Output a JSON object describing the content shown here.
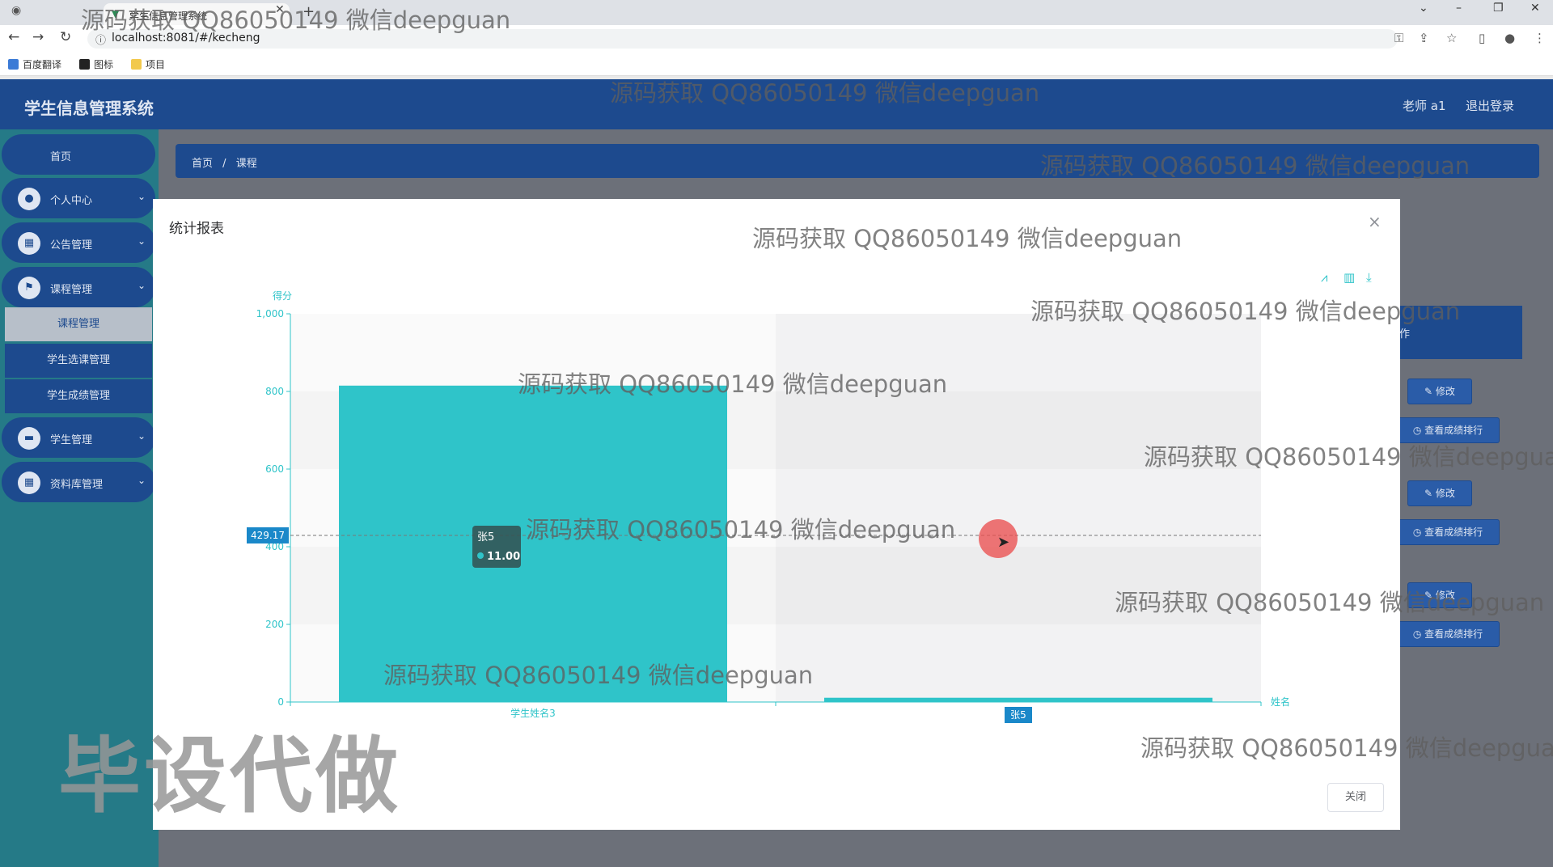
{
  "browser": {
    "tab_title": "学生信息管理系统",
    "url": "localhost:8081/#/kecheng",
    "bookmarks": [
      "百度翻译",
      "图标",
      "项目"
    ]
  },
  "app": {
    "title": "学生信息管理系统",
    "user": "老师 a1",
    "logout": "退出登录"
  },
  "sidebar": {
    "home": "首页",
    "personal": "个人中心",
    "notice": "公告管理",
    "course": "课程管理",
    "course_sub": [
      "课程管理",
      "学生选课管理",
      "学生成绩管理"
    ],
    "student": "学生管理",
    "library": "资料库管理"
  },
  "breadcrumb": {
    "home": "首页",
    "sep": "/",
    "current": "课程"
  },
  "background": {
    "ops_header": "作",
    "edit": "修改",
    "rank": "查看成绩排行"
  },
  "modal": {
    "title": "统计报表",
    "close_button": "关闭"
  },
  "chart_data": {
    "type": "bar",
    "ylabel": "得分",
    "xlabel": "姓名",
    "categories": [
      "学生姓名3",
      "张5"
    ],
    "values": [
      815,
      11
    ],
    "ylim": [
      0,
      1000
    ],
    "yticks": [
      "0",
      "200",
      "400",
      "600",
      "800",
      "1,000"
    ],
    "color": "#2fc4c9",
    "axis_pointer_value": "429.17",
    "tooltip": {
      "name": "张5",
      "value": "11.00"
    },
    "highlighted_category": "张5"
  },
  "watermarks": {
    "text": "源码获取 QQ86050149 微信deepguan",
    "big": "毕设代做"
  }
}
